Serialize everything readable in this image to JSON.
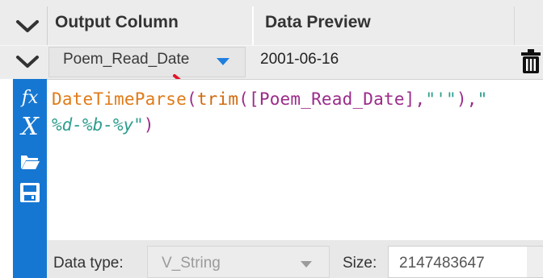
{
  "header": {
    "output_column_label": "Output Column",
    "data_preview_label": "Data Preview"
  },
  "row": {
    "output_column_value": "Poem_Read_Date",
    "data_preview_value": "2001-06-16"
  },
  "editor": {
    "expression_line1": {
      "fn": "DateTimeParse",
      "p1": "(",
      "fn2": "trim",
      "p2": "(",
      "field": "[Poem_Read_Date]",
      "sep1": ",",
      "str1": "\"'\"",
      "p3": "),",
      "str2_start": "\""
    },
    "expression_line2": {
      "str2_end": "%d-%b-%y\"",
      "p4": ")"
    },
    "tool_icons": [
      "function-icon",
      "variable-icon",
      "open-folder-icon",
      "save-icon"
    ]
  },
  "bottom": {
    "data_type_label": "Data type:",
    "data_type_value": "V_String",
    "size_label": "Size:",
    "size_value": "2147483647"
  },
  "colors": {
    "accent_blue": "#1677d2",
    "function_orange": "#e07b18",
    "field_purple": "#9b2c8a",
    "string_teal": "#2f9e8e"
  }
}
